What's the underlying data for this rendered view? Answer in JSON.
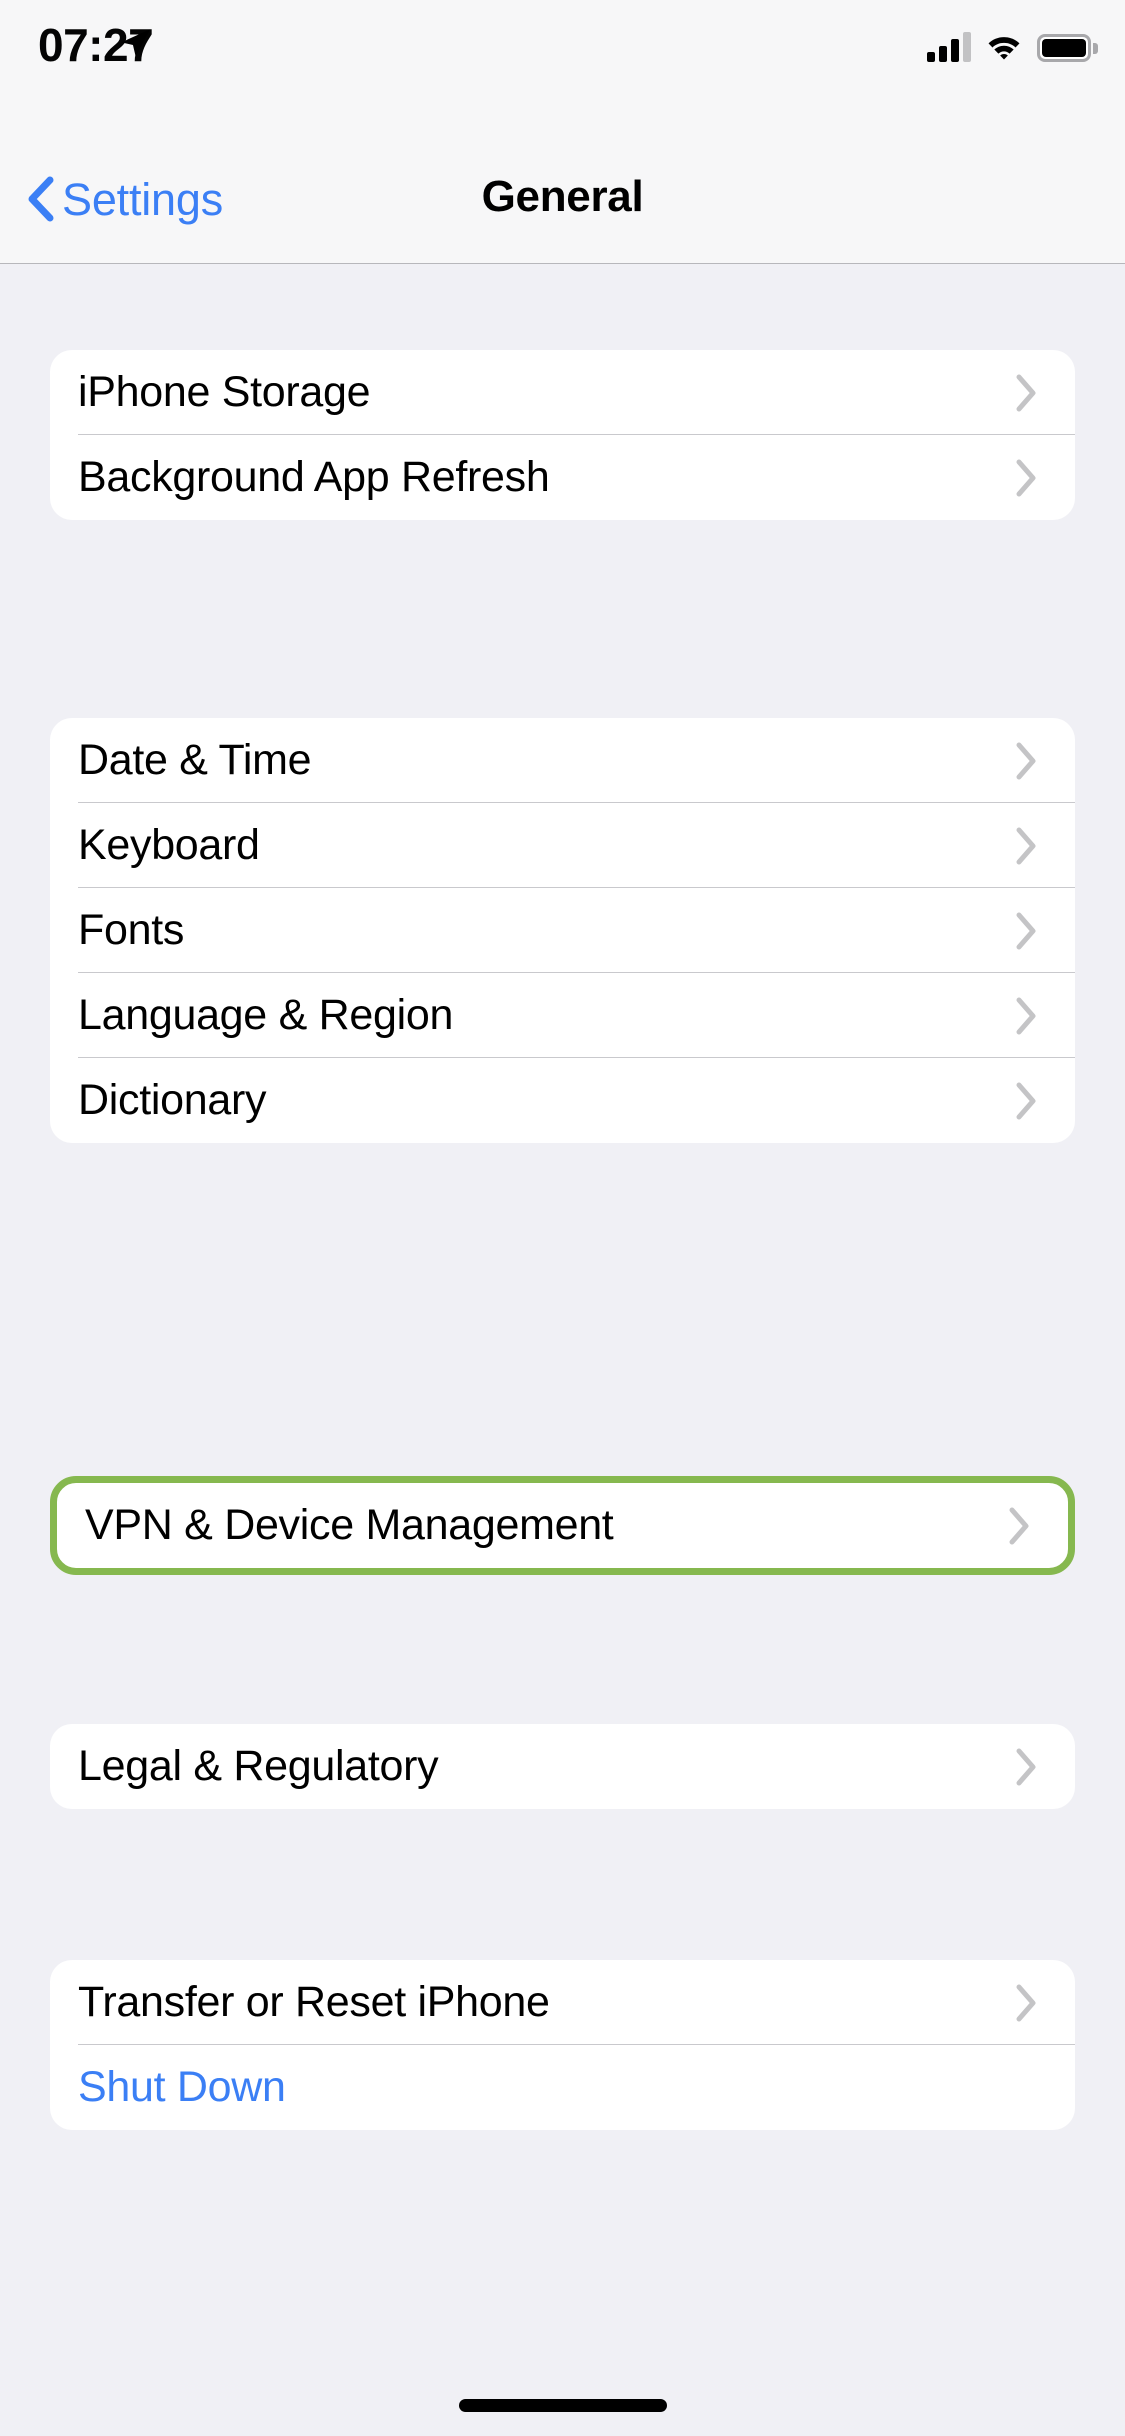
{
  "status_bar": {
    "time": "07:27",
    "location_icon": "location-arrow-icon",
    "cellular_icon": "cellular-bars-icon",
    "cellular_bars_filled": 3,
    "cellular_bars_total": 4,
    "wifi_icon": "wifi-icon",
    "battery_icon": "battery-icon",
    "battery_level_pct": 100
  },
  "nav": {
    "back_icon": "chevron-left-icon",
    "back_label": "Settings",
    "title": "General"
  },
  "colors": {
    "accent_blue": "#3b7ff5",
    "highlight_green": "#86b84f",
    "page_background": "#f0f0f5",
    "card_background": "#ffffff",
    "chevron_gray": "#c4c4c6",
    "separator": "#c9c9cd"
  },
  "groups": [
    {
      "id": "group-storage",
      "highlighted": false,
      "rows": [
        {
          "label": "iPhone Storage",
          "chevron": true,
          "style": "default",
          "name": "row-iphone-storage"
        },
        {
          "label": "Background App Refresh",
          "chevron": true,
          "style": "default",
          "name": "row-background-app-refresh"
        }
      ]
    },
    {
      "id": "group-localization",
      "highlighted": false,
      "rows": [
        {
          "label": "Date & Time",
          "chevron": true,
          "style": "default",
          "name": "row-date-and-time"
        },
        {
          "label": "Keyboard",
          "chevron": true,
          "style": "default",
          "name": "row-keyboard"
        },
        {
          "label": "Fonts",
          "chevron": true,
          "style": "default",
          "name": "row-fonts"
        },
        {
          "label": "Language & Region",
          "chevron": true,
          "style": "default",
          "name": "row-language-and-region"
        },
        {
          "label": "Dictionary",
          "chevron": true,
          "style": "default",
          "name": "row-dictionary"
        }
      ]
    },
    {
      "id": "group-vpn",
      "highlighted": true,
      "rows": [
        {
          "label": "VPN & Device Management",
          "chevron": true,
          "style": "default",
          "name": "row-vpn-device-management"
        }
      ]
    },
    {
      "id": "group-legal",
      "highlighted": false,
      "rows": [
        {
          "label": "Legal & Regulatory",
          "chevron": true,
          "style": "default",
          "name": "row-legal-and-regulatory"
        }
      ]
    },
    {
      "id": "group-reset",
      "highlighted": false,
      "rows": [
        {
          "label": "Transfer or Reset iPhone",
          "chevron": true,
          "style": "default",
          "name": "row-transfer-or-reset-iphone"
        },
        {
          "label": "Shut Down",
          "chevron": false,
          "style": "blue",
          "name": "row-shut-down"
        }
      ]
    }
  ],
  "home_indicator": "home-indicator"
}
